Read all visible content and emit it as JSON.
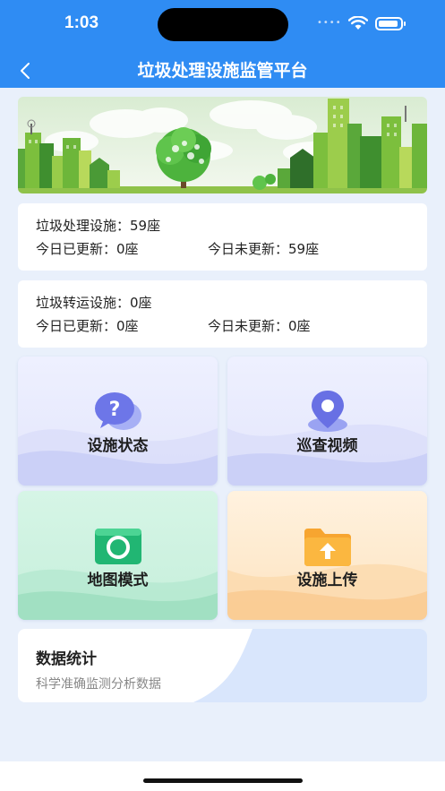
{
  "status_bar": {
    "time": "1:03",
    "signal_dots": "••••"
  },
  "nav": {
    "title": "垃圾处理设施监管平台"
  },
  "facilities": [
    {
      "title": "垃圾处理设施：59座",
      "updated": "今日已更新：0座",
      "not_updated": "今日未更新：59座"
    },
    {
      "title": "垃圾转运设施：0座",
      "updated": "今日已更新：0座",
      "not_updated": "今日未更新：0座"
    }
  ],
  "tiles": {
    "status": {
      "label": "设施状态",
      "icon": "question-chat-icon",
      "color": "#7a83ee"
    },
    "video": {
      "label": "巡查视频",
      "icon": "location-pin-icon",
      "color": "#6e78e6"
    },
    "map": {
      "label": "地图模式",
      "icon": "camera-icon",
      "color": "#2fbf7a"
    },
    "upload": {
      "label": "设施上传",
      "icon": "folder-upload-icon",
      "color": "#f5a623"
    }
  },
  "stats": {
    "title": "数据统计",
    "subtitle": "科学准确监测分析数据"
  },
  "colors": {
    "primary": "#2f8cf3",
    "background": "#e9f0fb"
  }
}
